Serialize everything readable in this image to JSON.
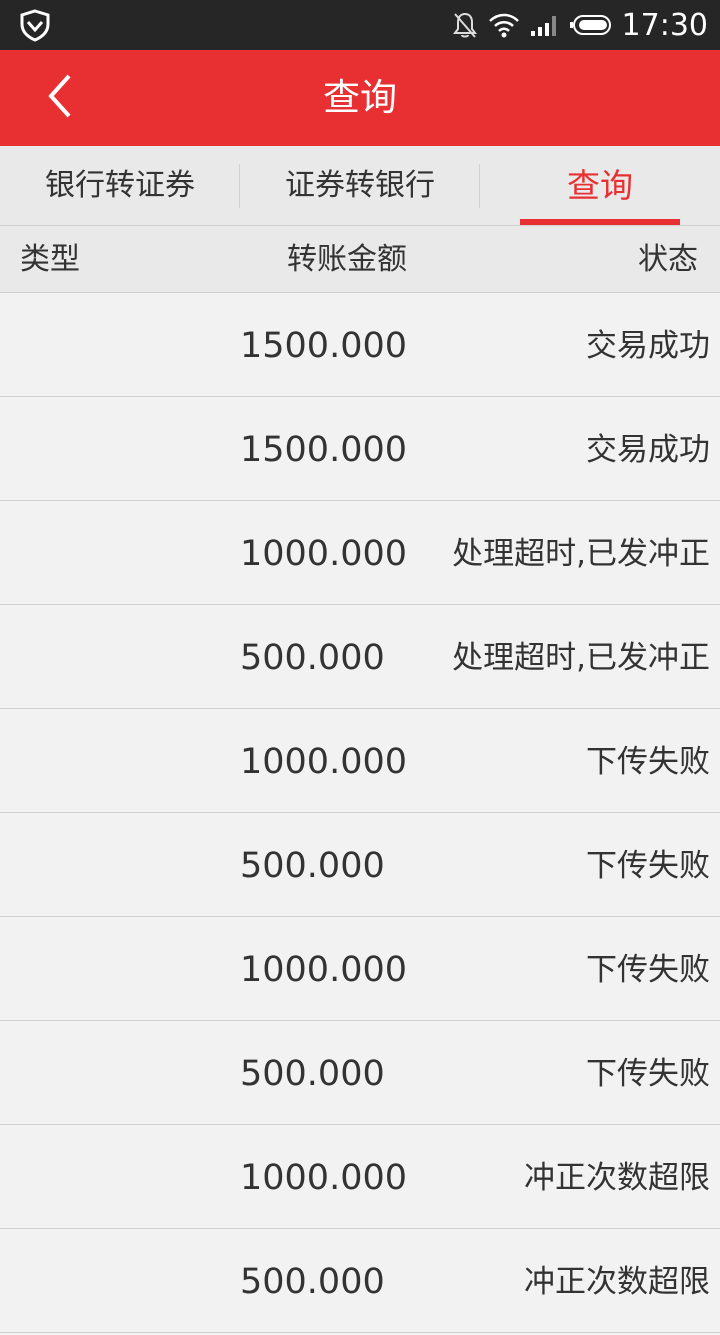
{
  "status_bar": {
    "time": "17:30",
    "icons": [
      "shield-icon",
      "bell-off-icon",
      "wifi-icon",
      "signal-icon",
      "battery-icon"
    ]
  },
  "header": {
    "title": "查询",
    "back_icon": "chevron-left-icon"
  },
  "tabs": [
    {
      "label": "银行转证券",
      "active": false
    },
    {
      "label": "证券转银行",
      "active": false
    },
    {
      "label": "查询",
      "active": true
    }
  ],
  "table": {
    "columns": [
      "类型",
      "转账金额",
      "状态"
    ],
    "rows": [
      {
        "type": "",
        "amount": "1500.000",
        "status": "交易成功"
      },
      {
        "type": "",
        "amount": "1500.000",
        "status": "交易成功"
      },
      {
        "type": "",
        "amount": "1000.000",
        "status": "处理超时,已发冲正"
      },
      {
        "type": "",
        "amount": "500.000",
        "status": "处理超时,已发冲正"
      },
      {
        "type": "",
        "amount": "1000.000",
        "status": "下传失败"
      },
      {
        "type": "",
        "amount": "500.000",
        "status": "下传失败"
      },
      {
        "type": "",
        "amount": "1000.000",
        "status": "下传失败"
      },
      {
        "type": "",
        "amount": "500.000",
        "status": "下传失败"
      },
      {
        "type": "",
        "amount": "1000.000",
        "status": "冲正次数超限"
      },
      {
        "type": "",
        "amount": "500.000",
        "status": "冲正次数超限"
      }
    ]
  },
  "colors": {
    "accent": "#e83032",
    "status_bar": "#262626",
    "background": "#f2f2f2",
    "tab_background": "#e9e9e9",
    "text": "#333333"
  }
}
